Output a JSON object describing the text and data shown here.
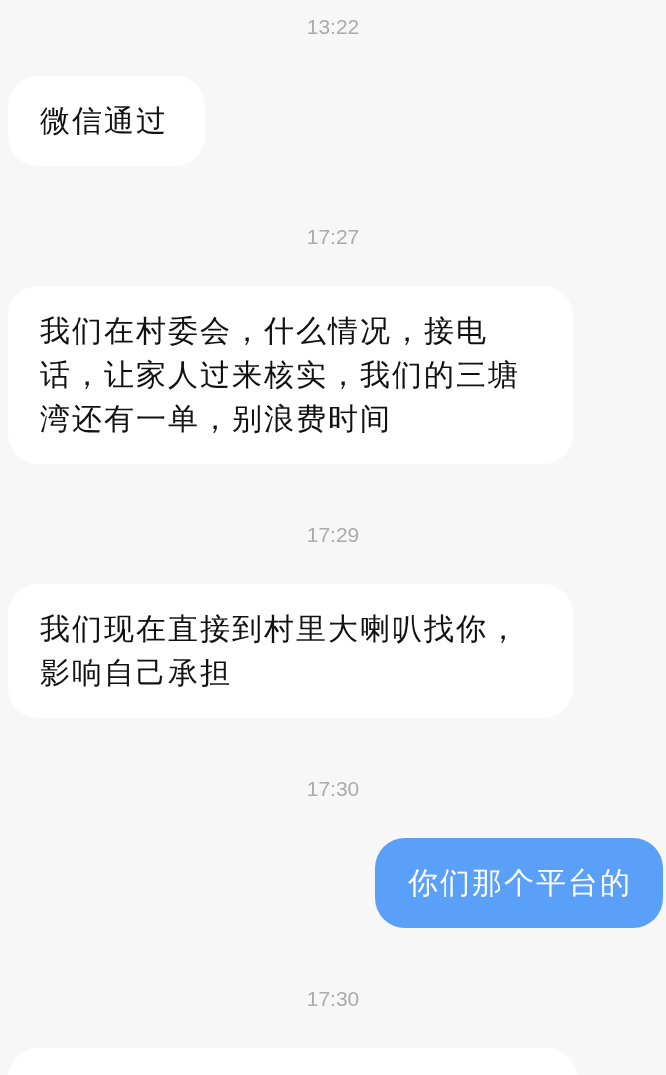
{
  "conversation": {
    "items": [
      {
        "kind": "time",
        "text": "13:22"
      },
      {
        "kind": "message",
        "outgoing": false,
        "text": "微信通过"
      },
      {
        "kind": "time",
        "text": "17:27"
      },
      {
        "kind": "message",
        "outgoing": false,
        "text": "我们在村委会，什么情况，接电话，让家人过来核实，我们的三塘湾还有一单，别浪费时间"
      },
      {
        "kind": "time",
        "text": "17:29"
      },
      {
        "kind": "message",
        "outgoing": false,
        "text": "我们现在直接到村里大喇叭找你，影响自己承担"
      },
      {
        "kind": "time",
        "text": "17:30"
      },
      {
        "kind": "message",
        "outgoing": true,
        "text": "你们那个平台的"
      },
      {
        "kind": "time",
        "text": "17:30"
      },
      {
        "kind": "partial_message",
        "outgoing": false
      }
    ]
  }
}
